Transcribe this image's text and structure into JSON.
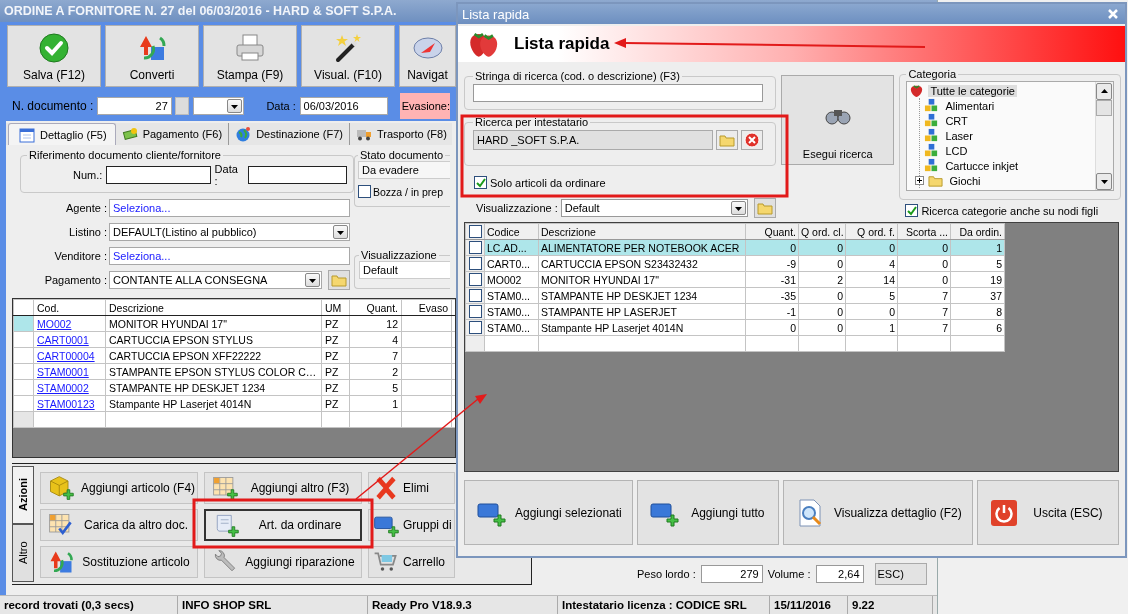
{
  "main_window": {
    "title": "ORDINE A FORNITORE N. 27 del 06/03/2016 - HARD & SOFT S.P.A.",
    "toolbar": [
      {
        "label": "Salva (F12)"
      },
      {
        "label": "Converti"
      },
      {
        "label": "Stampa (F9)"
      },
      {
        "label": "Visual. (F10)"
      },
      {
        "label": "Navigat"
      }
    ],
    "document": {
      "number_label": "N. documento :",
      "number": "27",
      "date_label": "Data :",
      "date": "06/03/2016",
      "evasione_label": "Evasione:"
    },
    "tabs": [
      {
        "label": "Dettaglio (F5)",
        "selected": true
      },
      {
        "label": "Pagamento (F6)",
        "selected": false
      },
      {
        "label": "Destinazione (F7)",
        "selected": false
      },
      {
        "label": "Trasporto (F8)",
        "selected": false
      }
    ],
    "reference": {
      "title": "Riferimento documento cliente/fornitore",
      "num_label": "Num.:",
      "date_label": "Data :"
    },
    "status_group": {
      "title": "Stato documento",
      "value": "Da evadere",
      "draft_label": "Bozza / in prep",
      "draft_checked": false
    },
    "fields": [
      {
        "label": "Agente :",
        "value": "Seleziona...",
        "kind": "link"
      },
      {
        "label": "Listino :",
        "value": "DEFAULT(Listino al pubblico)",
        "kind": "combo"
      },
      {
        "label": "Venditore :",
        "value": "Seleziona...",
        "kind": "link"
      },
      {
        "label": "Pagamento :",
        "value": "CONTANTE ALLA CONSEGNA",
        "kind": "combo-folder"
      }
    ],
    "view_group": {
      "title": "Visualizzazione",
      "value": "Default"
    },
    "table": {
      "columns": [
        "Cod.",
        "Descrizione",
        "UM",
        "Quant.",
        "Evaso"
      ],
      "rows": [
        {
          "selected": true,
          "cells": [
            "MO002",
            "MONITOR HYUNDAI 17\"",
            "PZ",
            "12"
          ]
        },
        {
          "selected": false,
          "cells": [
            "CART0001",
            "CARTUCCIA EPSON STYLUS",
            "PZ",
            "4"
          ]
        },
        {
          "selected": false,
          "cells": [
            "CART00004",
            "CARTUCCIA EPSON XFF22222",
            "PZ",
            "7"
          ]
        },
        {
          "selected": false,
          "cells": [
            "STAM0001",
            "STAMPANTE EPSON STYLUS COLOR C…",
            "PZ",
            "2"
          ]
        },
        {
          "selected": false,
          "cells": [
            "STAM0002",
            "STAMPANTE HP DESKJET 1234",
            "PZ",
            "5"
          ]
        },
        {
          "selected": false,
          "cells": [
            "STAM00123",
            "Stampante HP Laserjet 4014N",
            "PZ",
            "1"
          ]
        }
      ]
    },
    "action_tabs": [
      {
        "label": "Azioni",
        "selected": true
      },
      {
        "label": "Altro",
        "selected": false
      }
    ],
    "actions": [
      {
        "label": "Aggiungi articolo (F4)",
        "focused": false
      },
      {
        "label": "Aggiungi altro (F3)",
        "focused": false
      },
      {
        "label": "Elimi",
        "focused": false
      },
      {
        "label": "Carica da altro doc.",
        "focused": false
      },
      {
        "label": "Art. da ordinare",
        "focused": true
      },
      {
        "label": "Gruppi di",
        "focused": false
      },
      {
        "label": "Sostituzione articolo",
        "focused": false
      },
      {
        "label": "Aggiungi riparazione",
        "focused": false
      },
      {
        "label": "Carrello",
        "focused": false
      }
    ],
    "totals": {
      "gross_weight_label": "Peso lordo :",
      "gross_weight": "279",
      "volume_label": "Volume :",
      "volume": "2,64"
    },
    "exit_button_fragment": "ESC)"
  },
  "status_bar": [
    "record trovati (0,3 secs)",
    "INFO SHOP SRL",
    "Ready Pro V18.9.3",
    "Intestatario licenza : CODICE SRL",
    "15/11/2016",
    "9.22"
  ],
  "dialog": {
    "title": "Lista rapida",
    "header": "Lista rapida",
    "search": {
      "title": "Stringa di ricerca (cod. o descrizione) (F3)"
    },
    "owner_search": {
      "title": "Ricerca per intestatario",
      "value": "HARD _SOFT S.P.A."
    },
    "only_to_order": {
      "label": "Solo articoli da ordinare",
      "checked": true
    },
    "search_button": "Esegui ricerca",
    "category": {
      "title": "Categoria",
      "tree": [
        {
          "label": "Tutte le categorie",
          "kind": "all",
          "selected": true,
          "children": [
            {
              "label": "Alimentari",
              "kind": "category",
              "selected": false
            },
            {
              "label": "CRT",
              "kind": "category",
              "selected": false
            },
            {
              "label": "Laser",
              "kind": "category",
              "selected": false
            },
            {
              "label": "LCD",
              "kind": "category",
              "selected": false
            },
            {
              "label": "Cartucce inkjet",
              "kind": "category",
              "selected": false
            },
            {
              "label": "Giochi",
              "kind": "folder",
              "selected": false,
              "expanded": false
            }
          ]
        }
      ],
      "include_children": {
        "label": "Ricerca categorie anche su nodi figli",
        "checked": true
      }
    },
    "view": {
      "label": "Visualizzazione :",
      "value": "Default"
    },
    "table": {
      "select_all_checked": false,
      "columns": [
        "Codice",
        "Descrizione",
        "Quant.",
        "Q ord. cl.",
        "Q ord. f.",
        "Scorta ...",
        "Da ordin."
      ],
      "rows": [
        {
          "checked": false,
          "selected": true,
          "cells": [
            "LC.AD...",
            "ALIMENTATORE PER NOTEBOOK ACER",
            "0",
            "0",
            "0",
            "0",
            "1"
          ]
        },
        {
          "checked": false,
          "selected": false,
          "cells": [
            "CART0...",
            "CARTUCCIA EPSON S23432432",
            "-9",
            "0",
            "4",
            "0",
            "5"
          ]
        },
        {
          "checked": false,
          "selected": false,
          "cells": [
            "MO002",
            "MONITOR HYUNDAI 17\"",
            "-31",
            "2",
            "14",
            "0",
            "19"
          ]
        },
        {
          "checked": false,
          "selected": false,
          "cells": [
            "STAM0...",
            "STAMPANTE HP DESKJET 1234",
            "-35",
            "0",
            "5",
            "7",
            "37"
          ]
        },
        {
          "checked": false,
          "selected": false,
          "cells": [
            "STAM0...",
            "STAMPANTE HP LASERJET",
            "-1",
            "0",
            "0",
            "7",
            "8"
          ]
        },
        {
          "checked": false,
          "selected": false,
          "cells": [
            "STAM0...",
            "Stampante HP Laserjet 4014N",
            "0",
            "0",
            "1",
            "7",
            "6"
          ]
        }
      ]
    },
    "buttons": [
      "Aggiungi selezionati",
      "Aggiungi tutto",
      "Visualizza dettaglio (F2)",
      "Uscita (ESC)"
    ]
  }
}
